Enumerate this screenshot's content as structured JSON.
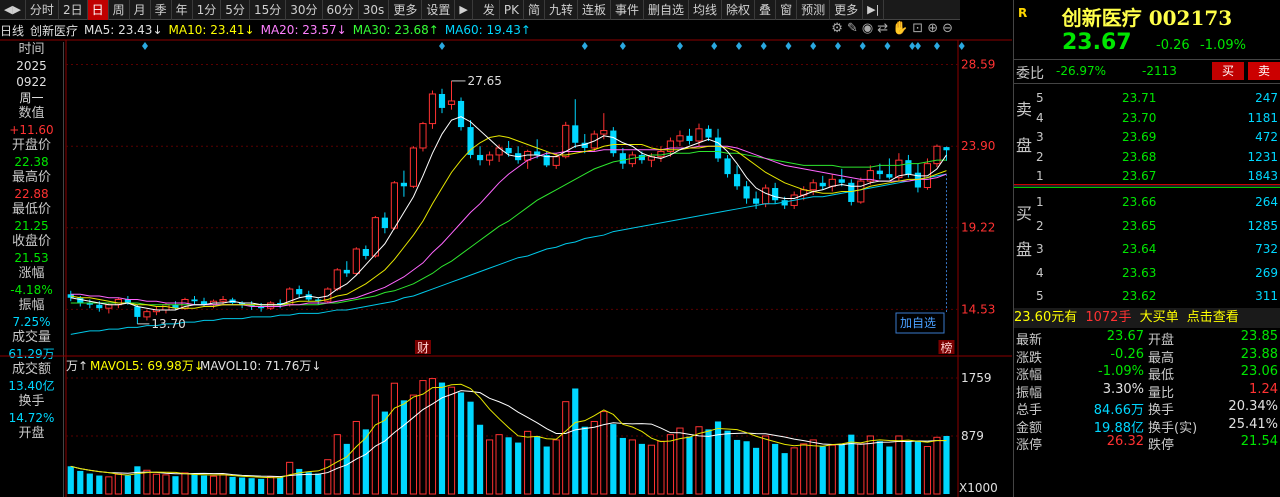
{
  "toolbar": {
    "items": [
      "分时",
      "2日",
      "日",
      "周",
      "月",
      "季",
      "年",
      "1分",
      "5分",
      "15分",
      "30分",
      "60分",
      "30s",
      "更多",
      "设置"
    ],
    "active": "日",
    "right_items": [
      "发",
      "PK",
      "简",
      "九转",
      "连板",
      "事件",
      "删自选",
      "均线",
      "除权",
      "叠",
      "窗",
      "预测",
      "更多"
    ]
  },
  "legend": {
    "period": "日线",
    "name": "创新医疗",
    "ma5": "MA5: 23.43↓",
    "ma10": "MA10: 23.41↓",
    "ma20": "MA20: 23.57↓",
    "ma30": "MA30: 23.68↑",
    "ma60": "MA60: 19.43↑"
  },
  "volume_legend": {
    "unit": "万↑",
    "mavol5": "MAVOL5: 69.98万↓",
    "mavol10": "MAVOL10: 71.76万↓"
  },
  "left_panel": [
    {
      "label": "时间",
      "value": "2025",
      "value2": "0922",
      "value3": "周一",
      "color": "#e0e0e0"
    },
    {
      "label": "数值",
      "value": "+11.60",
      "color": "#ff3232"
    },
    {
      "label": "开盘价",
      "value": "22.38",
      "color": "#00e600"
    },
    {
      "label": "最高价",
      "value": "22.88",
      "color": "#ff3232"
    },
    {
      "label": "最低价",
      "value": "21.25",
      "color": "#00e600"
    },
    {
      "label": "收盘价",
      "value": "21.53",
      "color": "#00e600"
    },
    {
      "label": "涨幅",
      "value": "-4.18%",
      "color": "#00e600"
    },
    {
      "label": "振幅",
      "value": "7.25%",
      "color": "#00d7ff"
    },
    {
      "label": "成交量",
      "value": "61.29万",
      "color": "#00d7ff"
    },
    {
      "label": "成交额",
      "value": "13.40亿",
      "color": "#00d7ff"
    },
    {
      "label": "换手",
      "value": "14.72%",
      "color": "#00d7ff"
    },
    {
      "label": "开盘",
      "value": "",
      "color": "#e0e0e0"
    }
  ],
  "axis": {
    "price_labels": [
      "28.59",
      "23.90",
      "19.22",
      "14.53"
    ],
    "volume_labels": [
      "1759",
      "879",
      "X1000"
    ],
    "high_marker": "27.65",
    "low_marker": "13.70",
    "event_markers": [
      "财",
      "榜"
    ],
    "add_watch": "加自选"
  },
  "quote": {
    "flag": "R",
    "title": "创新医疗  002173",
    "price": "23.67",
    "change": "-0.26",
    "change_pct": "-1.09%",
    "weibi_label": "委比",
    "weibi": "-26.97%",
    "weicha": "-2113",
    "buy_btn": "买",
    "sell_btn": "卖",
    "sell_side": "卖盘",
    "buy_side": "买盘",
    "asks": [
      {
        "i": "5",
        "p": "23.71",
        "q": "247"
      },
      {
        "i": "4",
        "p": "23.70",
        "q": "1181"
      },
      {
        "i": "3",
        "p": "23.69",
        "q": "472"
      },
      {
        "i": "2",
        "p": "23.68",
        "q": "1231"
      },
      {
        "i": "1",
        "p": "23.67",
        "q": "1843"
      }
    ],
    "bids": [
      {
        "i": "1",
        "p": "23.66",
        "q": "264"
      },
      {
        "i": "2",
        "p": "23.65",
        "q": "1285"
      },
      {
        "i": "3",
        "p": "23.64",
        "q": "732"
      },
      {
        "i": "4",
        "p": "23.63",
        "q": "269"
      },
      {
        "i": "5",
        "p": "23.62",
        "q": "311"
      }
    ],
    "bigorder": {
      "price": "23.60元有",
      "qty": "1072手",
      "label": "大买单",
      "link": "点击查看"
    },
    "stats": [
      {
        "k1": "最新",
        "v1": "23.67",
        "c1": "#00e600",
        "k2": "开盘",
        "v2": "23.85",
        "c2": "#00e600"
      },
      {
        "k1": "涨跌",
        "v1": "-0.26",
        "c1": "#00e600",
        "k2": "最高",
        "v2": "23.88",
        "c2": "#00e600"
      },
      {
        "k1": "涨幅",
        "v1": "-1.09%",
        "c1": "#00e600",
        "k2": "最低",
        "v2": "23.06",
        "c2": "#00e600"
      },
      {
        "k1": "振幅",
        "v1": "3.30%",
        "c1": "#e0e0e0",
        "k2": "量比",
        "v2": "1.24",
        "c2": "#ff3232"
      },
      {
        "k1": "总手",
        "v1": "84.66万",
        "c1": "#00d7ff",
        "k2": "换手",
        "v2": "20.34%",
        "c2": "#e0e0e0"
      },
      {
        "k1": "金额",
        "v1": "19.88亿",
        "c1": "#00d7ff",
        "k2": "换手(实)",
        "v2": "25.41%",
        "c2": "#e0e0e0"
      },
      {
        "k1": "涨停",
        "v1": "26.32",
        "c1": "#ff3232",
        "k2": "跌停",
        "v2": "21.54",
        "c2": "#00e600"
      }
    ]
  },
  "chart_data": {
    "type": "candlestick",
    "ylim": [
      12.2,
      30.0
    ],
    "ylabels": [
      28.59,
      23.9,
      19.22,
      14.53
    ],
    "candles": [
      [
        15.4,
        15.6,
        15.0,
        15.2
      ],
      [
        15.2,
        15.3,
        14.7,
        14.9
      ],
      [
        14.9,
        15.1,
        14.6,
        14.8
      ],
      [
        14.8,
        15.0,
        14.4,
        14.6
      ],
      [
        14.6,
        14.9,
        14.3,
        14.8
      ],
      [
        14.8,
        15.2,
        14.6,
        15.1
      ],
      [
        15.1,
        15.3,
        14.8,
        14.9
      ],
      [
        14.7,
        14.8,
        13.7,
        14.1
      ],
      [
        14.1,
        14.5,
        13.9,
        14.4
      ],
      [
        14.4,
        14.7,
        14.2,
        14.5
      ],
      [
        14.5,
        14.9,
        14.3,
        14.8
      ],
      [
        14.8,
        15.0,
        14.5,
        14.6
      ],
      [
        14.6,
        15.2,
        14.5,
        15.1
      ],
      [
        15.1,
        15.3,
        14.8,
        15.0
      ],
      [
        15.0,
        15.2,
        14.7,
        14.8
      ],
      [
        14.8,
        15.1,
        14.6,
        15.0
      ],
      [
        15.0,
        15.3,
        14.8,
        15.1
      ],
      [
        15.1,
        15.2,
        14.8,
        14.9
      ],
      [
        14.9,
        15.0,
        14.6,
        14.8
      ],
      [
        14.8,
        15.0,
        14.5,
        14.7
      ],
      [
        14.7,
        14.9,
        14.4,
        14.6
      ],
      [
        14.6,
        15.0,
        14.5,
        14.9
      ],
      [
        14.9,
        15.1,
        14.6,
        14.8
      ],
      [
        14.8,
        15.8,
        14.7,
        15.7
      ],
      [
        15.7,
        15.9,
        15.2,
        15.4
      ],
      [
        15.4,
        15.6,
        15.0,
        15.1
      ],
      [
        15.1,
        15.2,
        14.8,
        15.0
      ],
      [
        15.0,
        15.8,
        14.9,
        15.7
      ],
      [
        15.7,
        16.9,
        15.6,
        16.8
      ],
      [
        16.8,
        17.3,
        16.4,
        16.6
      ],
      [
        16.6,
        18.1,
        16.5,
        18.0
      ],
      [
        18.0,
        18.2,
        17.4,
        17.6
      ],
      [
        17.6,
        19.9,
        17.5,
        19.8
      ],
      [
        19.8,
        20.1,
        18.9,
        19.2
      ],
      [
        19.2,
        21.9,
        19.1,
        21.8
      ],
      [
        21.8,
        22.5,
        21.0,
        21.6
      ],
      [
        21.6,
        23.9,
        21.5,
        23.8
      ],
      [
        23.8,
        25.3,
        23.6,
        25.2
      ],
      [
        25.2,
        27.1,
        24.9,
        26.9
      ],
      [
        26.9,
        27.2,
        25.8,
        26.1
      ],
      [
        26.3,
        27.65,
        26.0,
        26.5
      ],
      [
        26.5,
        26.7,
        24.8,
        25.0
      ],
      [
        25.0,
        25.4,
        23.2,
        23.4
      ],
      [
        23.4,
        23.9,
        22.8,
        23.1
      ],
      [
        23.1,
        23.6,
        22.8,
        23.4
      ],
      [
        23.4,
        24.0,
        23.0,
        23.8
      ],
      [
        23.8,
        24.2,
        23.3,
        23.5
      ],
      [
        23.5,
        23.9,
        22.9,
        23.1
      ],
      [
        23.1,
        23.7,
        22.6,
        23.6
      ],
      [
        23.6,
        24.3,
        23.2,
        23.4
      ],
      [
        23.4,
        23.6,
        22.7,
        22.8
      ],
      [
        22.8,
        23.5,
        22.6,
        23.3
      ],
      [
        23.3,
        25.3,
        23.2,
        25.1
      ],
      [
        25.1,
        26.6,
        23.8,
        24.1
      ],
      [
        24.1,
        24.6,
        23.5,
        23.8
      ],
      [
        23.8,
        24.8,
        23.6,
        24.6
      ],
      [
        24.6,
        25.8,
        24.3,
        24.8
      ],
      [
        24.8,
        25.0,
        23.3,
        23.5
      ],
      [
        23.5,
        23.8,
        22.6,
        22.9
      ],
      [
        22.9,
        23.6,
        22.7,
        23.4
      ],
      [
        23.4,
        23.6,
        22.9,
        23.1
      ],
      [
        23.1,
        23.5,
        22.7,
        23.3
      ],
      [
        23.3,
        23.9,
        23.0,
        23.6
      ],
      [
        23.6,
        24.4,
        23.3,
        24.2
      ],
      [
        24.2,
        24.8,
        23.9,
        24.5
      ],
      [
        24.5,
        24.9,
        24.0,
        24.2
      ],
      [
        24.2,
        25.2,
        23.9,
        24.9
      ],
      [
        24.9,
        25.1,
        24.2,
        24.4
      ],
      [
        24.4,
        24.9,
        23.0,
        23.2
      ],
      [
        23.2,
        23.4,
        22.1,
        22.3
      ],
      [
        22.3,
        22.8,
        21.4,
        21.6
      ],
      [
        21.6,
        21.9,
        20.6,
        20.9
      ],
      [
        20.9,
        21.3,
        20.3,
        20.6
      ],
      [
        20.6,
        21.7,
        20.4,
        21.5
      ],
      [
        21.5,
        21.8,
        20.6,
        20.8
      ],
      [
        20.8,
        21.0,
        20.3,
        20.5
      ],
      [
        20.5,
        21.3,
        20.3,
        21.1
      ],
      [
        21.1,
        21.6,
        20.8,
        21.4
      ],
      [
        21.4,
        22.0,
        21.1,
        21.8
      ],
      [
        21.8,
        22.2,
        21.4,
        21.6
      ],
      [
        21.6,
        22.3,
        21.3,
        22.0
      ],
      [
        22.0,
        22.6,
        21.6,
        21.8
      ],
      [
        21.8,
        22.0,
        20.5,
        20.7
      ],
      [
        20.7,
        22.1,
        20.6,
        21.9
      ],
      [
        21.9,
        22.8,
        21.7,
        22.5
      ],
      [
        22.5,
        22.9,
        22.0,
        22.3
      ],
      [
        22.3,
        23.2,
        22.0,
        22.1
      ],
      [
        22.1,
        23.5,
        21.9,
        23.1
      ],
      [
        23.1,
        23.4,
        22.1,
        22.3
      ],
      [
        22.38,
        22.88,
        21.25,
        21.53
      ],
      [
        21.53,
        23.2,
        21.4,
        22.9
      ],
      [
        22.9,
        24.0,
        22.7,
        23.9
      ],
      [
        23.85,
        23.88,
        23.06,
        23.67
      ]
    ],
    "ma5": [
      15.2,
      15.1,
      15.0,
      14.9,
      14.8,
      14.8,
      14.9,
      14.7,
      14.6,
      14.5,
      14.5,
      14.5,
      14.7,
      14.8,
      14.8,
      14.9,
      14.9,
      15.0,
      14.9,
      14.9,
      14.8,
      14.8,
      14.8,
      15.0,
      15.2,
      15.3,
      15.2,
      15.3,
      15.7,
      16.0,
      16.5,
      17.1,
      17.7,
      18.3,
      19.2,
      20.1,
      21.0,
      22.2,
      23.5,
      24.6,
      25.4,
      25.6,
      25.3,
      24.8,
      24.3,
      23.8,
      23.4,
      23.3,
      23.4,
      23.4,
      23.3,
      23.3,
      23.6,
      23.9,
      24.0,
      24.2,
      24.5,
      24.4,
      24.1,
      23.9,
      23.5,
      23.3,
      23.2,
      23.4,
      23.7,
      23.9,
      24.1,
      24.3,
      24.1,
      23.6,
      22.9,
      22.1,
      21.5,
      21.2,
      21.0,
      20.9,
      20.9,
      21.1,
      21.3,
      21.4,
      21.6,
      21.7,
      21.6,
      21.6,
      21.8,
      21.9,
      21.9,
      22.2,
      22.3,
      22.2,
      22.2,
      22.6,
      23.4
    ],
    "ma10": [
      15.3,
      15.2,
      15.2,
      15.1,
      15.0,
      14.9,
      14.9,
      14.8,
      14.8,
      14.7,
      14.7,
      14.6,
      14.6,
      14.6,
      14.7,
      14.7,
      14.8,
      14.8,
      14.8,
      14.8,
      14.8,
      14.8,
      14.8,
      14.9,
      15.0,
      15.0,
      15.0,
      15.1,
      15.3,
      15.4,
      15.7,
      16.0,
      16.4,
      16.8,
      17.4,
      18.1,
      18.8,
      19.6,
      20.6,
      21.5,
      22.4,
      23.1,
      23.7,
      24.1,
      24.4,
      24.5,
      24.4,
      24.2,
      24.0,
      23.8,
      23.6,
      23.4,
      23.4,
      23.5,
      23.6,
      23.7,
      23.9,
      24.0,
      24.0,
      24.0,
      24.0,
      23.8,
      23.7,
      23.7,
      23.7,
      23.8,
      23.8,
      23.9,
      23.9,
      23.8,
      23.6,
      23.2,
      22.8,
      22.4,
      22.1,
      21.8,
      21.6,
      21.4,
      21.3,
      21.2,
      21.2,
      21.3,
      21.3,
      21.4,
      21.6,
      21.7,
      21.8,
      21.9,
      22.0,
      22.0,
      22.1,
      22.3,
      22.5
    ],
    "ma20": [
      15.4,
      15.4,
      15.3,
      15.3,
      15.2,
      15.2,
      15.1,
      15.1,
      15.0,
      15.0,
      14.9,
      14.9,
      14.9,
      14.8,
      14.8,
      14.8,
      14.8,
      14.8,
      14.8,
      14.7,
      14.7,
      14.7,
      14.7,
      14.8,
      14.8,
      14.9,
      14.9,
      14.9,
      15.0,
      15.1,
      15.2,
      15.4,
      15.6,
      15.8,
      16.1,
      16.4,
      16.8,
      17.2,
      17.8,
      18.3,
      18.9,
      19.5,
      20.1,
      20.6,
      21.2,
      21.8,
      22.3,
      22.7,
      23.1,
      23.3,
      23.5,
      23.5,
      23.6,
      23.6,
      23.6,
      23.6,
      23.7,
      23.7,
      23.7,
      23.7,
      23.7,
      23.7,
      23.7,
      23.8,
      23.8,
      23.8,
      23.9,
      23.9,
      23.9,
      23.9,
      23.8,
      23.6,
      23.4,
      23.2,
      23.0,
      22.8,
      22.7,
      22.6,
      22.5,
      22.4,
      22.3,
      22.2,
      22.1,
      22.0,
      22.0,
      21.9,
      21.9,
      21.9,
      21.9,
      22.0,
      22.0,
      22.1,
      22.3
    ],
    "ma30": [
      14.9,
      14.9,
      14.9,
      14.9,
      14.9,
      14.9,
      14.9,
      14.9,
      14.8,
      14.8,
      14.8,
      14.8,
      14.8,
      14.8,
      14.8,
      14.8,
      14.8,
      14.8,
      14.8,
      14.8,
      14.8,
      14.8,
      14.8,
      14.8,
      14.8,
      14.8,
      14.8,
      14.9,
      14.9,
      15.0,
      15.1,
      15.2,
      15.3,
      15.5,
      15.6,
      15.8,
      16.0,
      16.3,
      16.6,
      17.0,
      17.3,
      17.7,
      18.1,
      18.5,
      18.9,
      19.3,
      19.6,
      20.0,
      20.4,
      20.8,
      21.1,
      21.4,
      21.7,
      22.0,
      22.3,
      22.6,
      22.8,
      23.0,
      23.1,
      23.2,
      23.3,
      23.4,
      23.4,
      23.5,
      23.5,
      23.5,
      23.6,
      23.6,
      23.6,
      23.5,
      23.5,
      23.4,
      23.3,
      23.2,
      23.1,
      23.0,
      22.9,
      22.8,
      22.8,
      22.8,
      22.8,
      22.7,
      22.7,
      22.7,
      22.7,
      22.8,
      22.8,
      22.8,
      22.9,
      22.9,
      23.0,
      23.1,
      23.1
    ],
    "ma60": [
      13.1,
      13.2,
      13.3,
      13.3,
      13.4,
      13.4,
      13.5,
      13.5,
      13.6,
      13.6,
      13.7,
      13.7,
      13.8,
      13.8,
      13.9,
      13.9,
      14.0,
      14.0,
      14.0,
      14.1,
      14.1,
      14.1,
      14.2,
      14.2,
      14.3,
      14.3,
      14.3,
      14.4,
      14.5,
      14.5,
      14.6,
      14.7,
      14.8,
      14.9,
      15.0,
      15.2,
      15.3,
      15.5,
      15.7,
      15.9,
      16.1,
      16.3,
      16.5,
      16.7,
      16.9,
      17.1,
      17.3,
      17.5,
      17.6,
      17.8,
      18.0,
      18.1,
      18.3,
      18.4,
      18.6,
      18.7,
      18.8,
      19.0,
      19.1,
      19.2,
      19.3,
      19.4,
      19.5,
      19.6,
      19.7,
      19.8,
      19.9,
      20.0,
      20.1,
      20.2,
      20.3,
      20.4,
      20.5,
      20.6,
      20.6,
      20.7,
      20.8,
      20.9,
      21.0,
      21.0,
      21.1,
      21.2,
      21.3,
      21.4,
      21.5,
      21.6,
      21.7,
      21.8,
      21.9,
      22.0,
      22.1,
      22.2,
      22.3
    ],
    "volumes": [
      420,
      350,
      310,
      280,
      260,
      300,
      280,
      420,
      360,
      300,
      290,
      270,
      320,
      300,
      280,
      270,
      290,
      260,
      250,
      240,
      230,
      260,
      250,
      480,
      380,
      330,
      310,
      520,
      900,
      760,
      1100,
      980,
      1500,
      1250,
      1680,
      1420,
      1500,
      1720,
      1750,
      1690,
      1620,
      1540,
      1400,
      1050,
      820,
      900,
      860,
      780,
      950,
      880,
      720,
      820,
      1400,
      1600,
      1020,
      1100,
      1250,
      1060,
      850,
      820,
      760,
      740,
      800,
      900,
      1000,
      870,
      1020,
      980,
      1100,
      960,
      820,
      800,
      700,
      880,
      760,
      620,
      700,
      760,
      820,
      720,
      740,
      760,
      900,
      760,
      880,
      800,
      720,
      880,
      800,
      800,
      720,
      860,
      880
    ],
    "vol_ylim": [
      0,
      1850
    ]
  }
}
